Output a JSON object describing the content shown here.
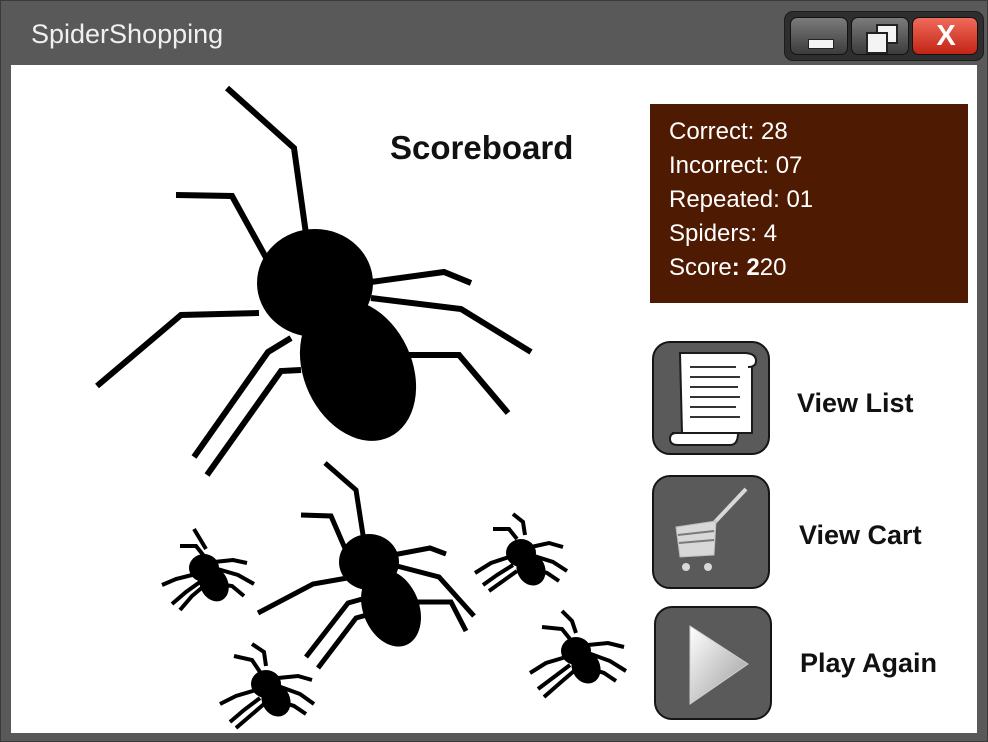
{
  "window": {
    "title": "SpiderShopping",
    "controls": {
      "minimize_icon": "minimize-icon",
      "maximize_icon": "restore-icon",
      "close_label": "X"
    }
  },
  "scoreboard": {
    "heading": "Scoreboard",
    "correct_label": "Correct:",
    "correct_value": "28",
    "incorrect_label": "Incorrect:",
    "incorrect_value": "07",
    "repeated_label": "Repeated:",
    "repeated_value": "01",
    "spiders_label": "Spiders:",
    "spiders_value": "4",
    "score_label": "Score",
    "score_sep": ":",
    "score_value_first": "2",
    "score_value_rest": "20"
  },
  "actions": {
    "view_list": {
      "label": "View List",
      "icon": "scroll-list-icon"
    },
    "view_cart": {
      "label": "View Cart",
      "icon": "shopping-cart-icon"
    },
    "play_again": {
      "label": "Play Again",
      "icon": "play-icon"
    }
  },
  "colors": {
    "titlebar": "#595959",
    "scoreboard_panel": "#4f1a02",
    "close_button": "#d9321f",
    "spider": "#000000"
  }
}
